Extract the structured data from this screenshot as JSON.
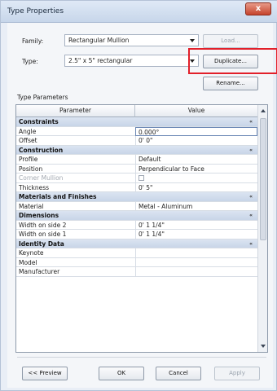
{
  "window": {
    "title": "Type Properties",
    "close_glyph": "x"
  },
  "family": {
    "label": "Family:",
    "value": "Rectangular Mullion",
    "load_label": "Load..."
  },
  "type": {
    "label": "Type:",
    "value": "2.5\" x 5\" rectangular",
    "duplicate_label": "Duplicate...",
    "rename_label": "Rename..."
  },
  "type_parameters": {
    "label": "Type Parameters",
    "col_parameter": "Parameter",
    "col_value": "Value",
    "rows": [
      {
        "kind": "group",
        "name": "Constraints"
      },
      {
        "kind": "item",
        "name": "Angle",
        "value": "0.000°",
        "selected": true
      },
      {
        "kind": "item",
        "name": "Offset",
        "value": "0'  0\""
      },
      {
        "kind": "group",
        "name": "Construction"
      },
      {
        "kind": "item",
        "name": "Profile",
        "value": "Default"
      },
      {
        "kind": "item",
        "name": "Position",
        "value": "Perpendicular to Face"
      },
      {
        "kind": "checkbox",
        "name": "Corner Mullion",
        "value": "",
        "disabled": true
      },
      {
        "kind": "item",
        "name": "Thickness",
        "value": "0'  5\""
      },
      {
        "kind": "group",
        "name": "Materials and Finishes"
      },
      {
        "kind": "item",
        "name": "Material",
        "value": "Metal - Aluminum"
      },
      {
        "kind": "group",
        "name": "Dimensions"
      },
      {
        "kind": "item",
        "name": "Width on side 2",
        "value": "0'  1 1/4\""
      },
      {
        "kind": "item",
        "name": "Width on side 1",
        "value": "0'  1 1/4\""
      },
      {
        "kind": "group",
        "name": "Identity Data"
      },
      {
        "kind": "item",
        "name": "Keynote",
        "value": ""
      },
      {
        "kind": "item",
        "name": "Model",
        "value": ""
      },
      {
        "kind": "item",
        "name": "Manufacturer",
        "value": ""
      }
    ]
  },
  "footer": {
    "preview_label": "<< Preview",
    "ok_label": "OK",
    "cancel_label": "Cancel",
    "apply_label": "Apply"
  },
  "colors": {
    "highlight": "#e2202a",
    "group_header": "#c8d5e8"
  }
}
